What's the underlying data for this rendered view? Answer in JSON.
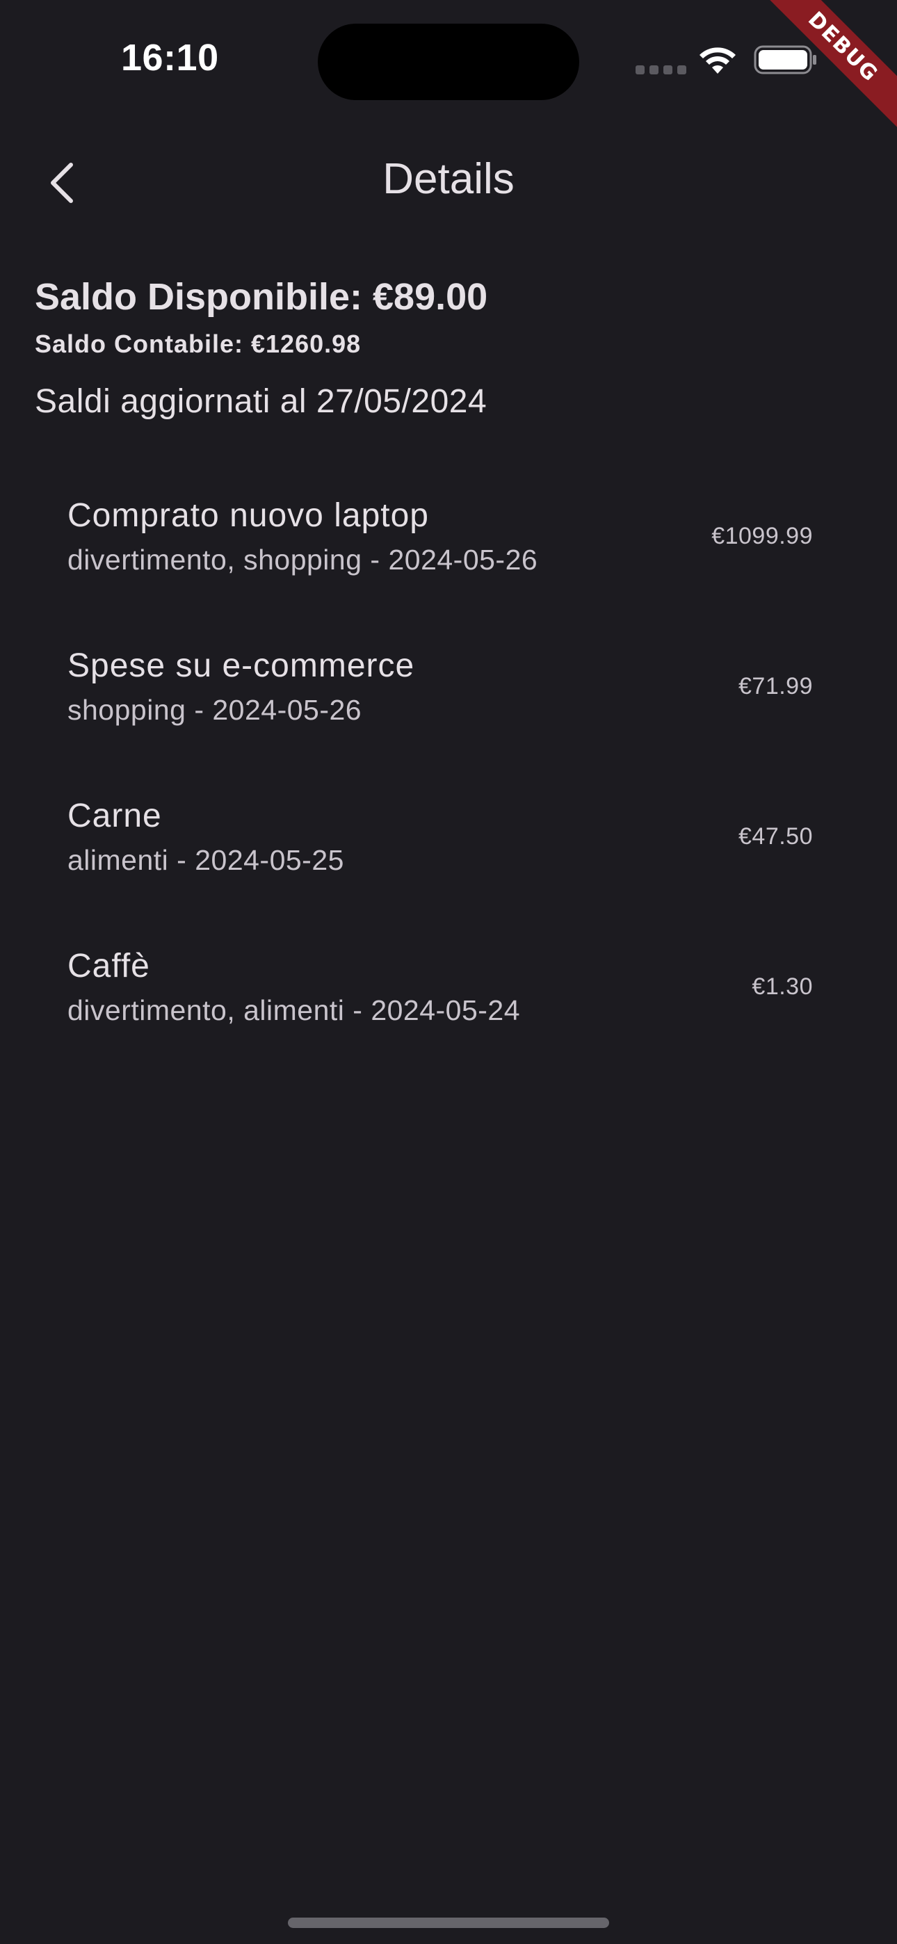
{
  "status_bar": {
    "time": "16:10"
  },
  "debug_banner": "DEBUG",
  "header": {
    "title": "Details",
    "back_icon": "chevron-left-icon"
  },
  "balances": {
    "available": "Saldo Disponibile: €89.00",
    "accounting": "Saldo Contabile: €1260.98",
    "updated": "Saldi aggiornati al 27/05/2024"
  },
  "transactions": [
    {
      "title": "Comprato nuovo laptop",
      "subtitle": "divertimento, shopping - 2024-05-26",
      "amount": "€1099.99"
    },
    {
      "title": "Spese su e-commerce",
      "subtitle": "shopping - 2024-05-26",
      "amount": "€71.99"
    },
    {
      "title": "Carne",
      "subtitle": "alimenti - 2024-05-25",
      "amount": "€47.50"
    },
    {
      "title": "Caffè",
      "subtitle": "divertimento, alimenti - 2024-05-24",
      "amount": "€1.30"
    }
  ],
  "colors": {
    "background": "#1c1b20",
    "text_primary": "#e6e1e6",
    "text_secondary": "#c9c4cc",
    "debug_banner": "#8a1c22"
  }
}
